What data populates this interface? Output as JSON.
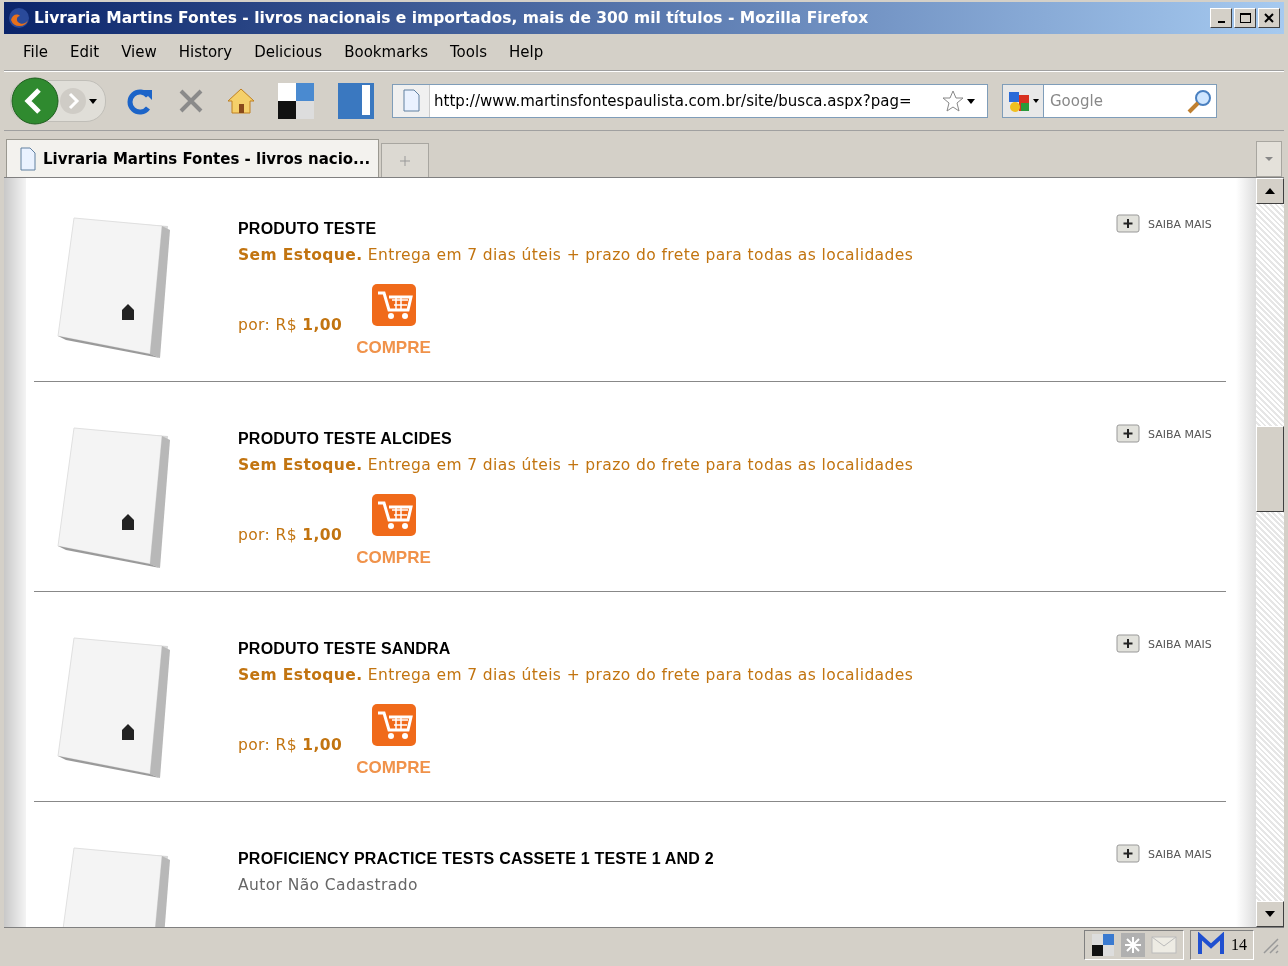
{
  "window": {
    "title": "Livraria Martins Fontes - livros nacionais e importados, mais de 300 mil títulos - Mozilla Firefox"
  },
  "menu": [
    {
      "label": "File"
    },
    {
      "label": "Edit"
    },
    {
      "label": "View"
    },
    {
      "label": "History"
    },
    {
      "label": "Delicious"
    },
    {
      "label": "Bookmarks"
    },
    {
      "label": "Tools"
    },
    {
      "label": "Help"
    }
  ],
  "navbar": {
    "url": "http://www.martinsfontespaulista.com.br/site/busca.aspx?pag=",
    "search": {
      "placeholder": "Google"
    }
  },
  "tabs": [
    {
      "label": "Livraria Martins Fontes - livros nacio...",
      "selected": true
    }
  ],
  "products": [
    {
      "kind": "stock",
      "name": "PRODUTO TESTE",
      "line": "**Sem Estoque.** Entrega em 7 dias úteis + prazo do frete para todas as localidades",
      "price": "por: R$ **1,00**",
      "buy": "COMPRE",
      "more": "SAIBA MAIS"
    },
    {
      "kind": "stock",
      "name": "PRODUTO TESTE ALCIDES",
      "line": "**Sem Estoque.** Entrega em 7 dias úteis + prazo do frete para todas as localidades",
      "price": "por: R$ **1,00**",
      "buy": "COMPRE",
      "more": "SAIBA MAIS"
    },
    {
      "kind": "stock",
      "name": "PRODUTO TESTE SANDRA",
      "line": "**Sem Estoque.** Entrega em 7 dias úteis + prazo do frete para todas as localidades",
      "price": "por: R$ **1,00**",
      "buy": "COMPRE",
      "more": "SAIBA MAIS"
    },
    {
      "kind": "author",
      "name": "PROFICIENCY PRACTICE TESTS CASSETE 1 TESTE 1 AND 2",
      "line": "Autor Não Cadastrado",
      "more": "SAIBA MAIS"
    }
  ],
  "status_bar": {
    "mail_count": "14"
  }
}
